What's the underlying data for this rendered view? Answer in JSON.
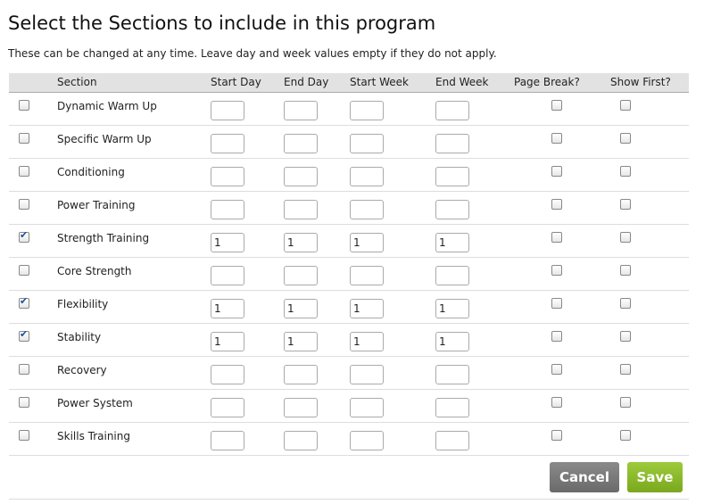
{
  "title": "Select the Sections to include in this program",
  "subtitle": "These can be changed at any time. Leave day and week values empty if they do not apply.",
  "columns": [
    "",
    "Section",
    "Start Day",
    "End Day",
    "Start Week",
    "End Week",
    "Page Break?",
    "Show First?"
  ],
  "rows": [
    {
      "name": "Dynamic Warm Up",
      "checked": false,
      "start_day": "",
      "end_day": "",
      "start_week": "",
      "end_week": "",
      "page_break": false,
      "show_first": false
    },
    {
      "name": "Specific Warm Up",
      "checked": false,
      "start_day": "",
      "end_day": "",
      "start_week": "",
      "end_week": "",
      "page_break": false,
      "show_first": false
    },
    {
      "name": "Conditioning",
      "checked": false,
      "start_day": "",
      "end_day": "",
      "start_week": "",
      "end_week": "",
      "page_break": false,
      "show_first": false
    },
    {
      "name": "Power Training",
      "checked": false,
      "start_day": "",
      "end_day": "",
      "start_week": "",
      "end_week": "",
      "page_break": false,
      "show_first": false
    },
    {
      "name": "Strength Training",
      "checked": true,
      "start_day": "1",
      "end_day": "1",
      "start_week": "1",
      "end_week": "1",
      "page_break": false,
      "show_first": false
    },
    {
      "name": "Core Strength",
      "checked": false,
      "start_day": "",
      "end_day": "",
      "start_week": "",
      "end_week": "",
      "page_break": false,
      "show_first": false
    },
    {
      "name": "Flexibility",
      "checked": true,
      "start_day": "1",
      "end_day": "1",
      "start_week": "1",
      "end_week": "1",
      "page_break": false,
      "show_first": false
    },
    {
      "name": "Stability",
      "checked": true,
      "start_day": "1",
      "end_day": "1",
      "start_week": "1",
      "end_week": "1",
      "page_break": false,
      "show_first": false
    },
    {
      "name": "Recovery",
      "checked": false,
      "start_day": "",
      "end_day": "",
      "start_week": "",
      "end_week": "",
      "page_break": false,
      "show_first": false
    },
    {
      "name": "Power System",
      "checked": false,
      "start_day": "",
      "end_day": "",
      "start_week": "",
      "end_week": "",
      "page_break": false,
      "show_first": false
    },
    {
      "name": "Skills Training",
      "checked": false,
      "start_day": "",
      "end_day": "",
      "start_week": "",
      "end_week": "",
      "page_break": false,
      "show_first": false
    }
  ],
  "buttons": {
    "cancel": "Cancel",
    "save": "Save"
  }
}
